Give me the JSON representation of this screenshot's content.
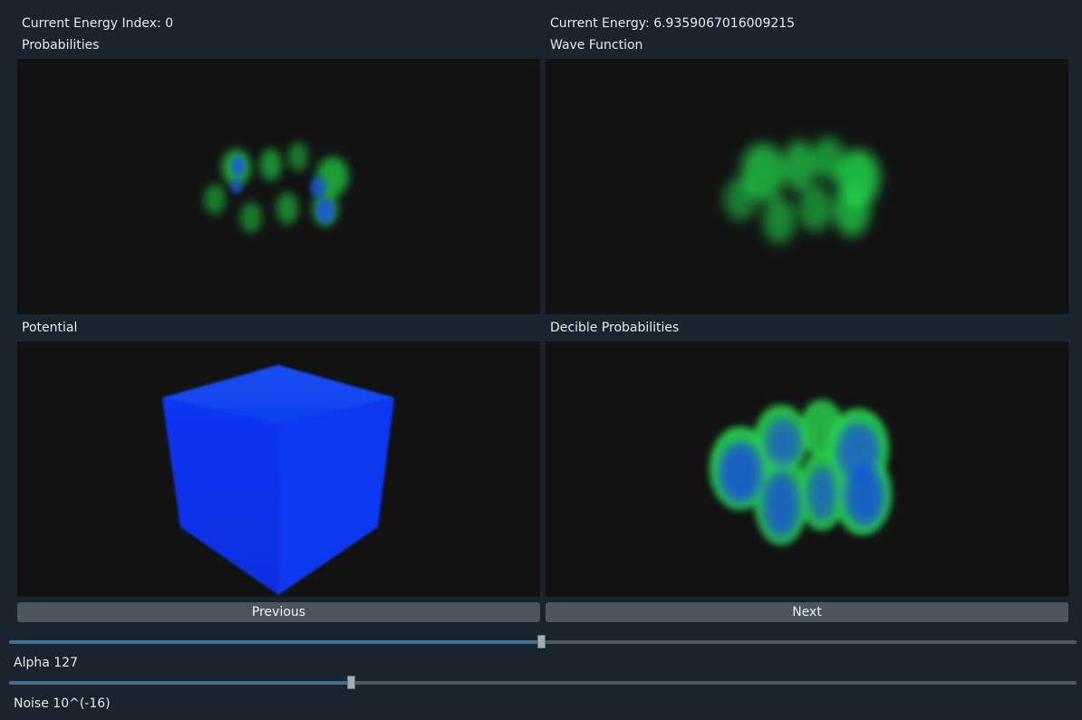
{
  "header": {
    "energy_index_label": "Current Energy Index: 0",
    "energy_label": "Current Energy: 6.9359067016009215"
  },
  "panels": {
    "probabilities": {
      "title": "Probabilities"
    },
    "wave_function": {
      "title": "Wave Function"
    },
    "potential": {
      "title": "Potential"
    },
    "decible_probabilities": {
      "title": "Decible Probabilities"
    }
  },
  "navigation": {
    "previous_label": "Previous",
    "next_label": "Next"
  },
  "sliders": {
    "alpha": {
      "label": "Alpha 127",
      "value": 127,
      "max": 255
    },
    "noise": {
      "label": "Noise 10^(-16)",
      "fraction": 0.32
    }
  },
  "colors": {
    "background": "#1a242e",
    "viewport": "#121212",
    "green": "#22d34a",
    "blue": "#0a3cf0",
    "slider_fill": "#3f6f96"
  }
}
